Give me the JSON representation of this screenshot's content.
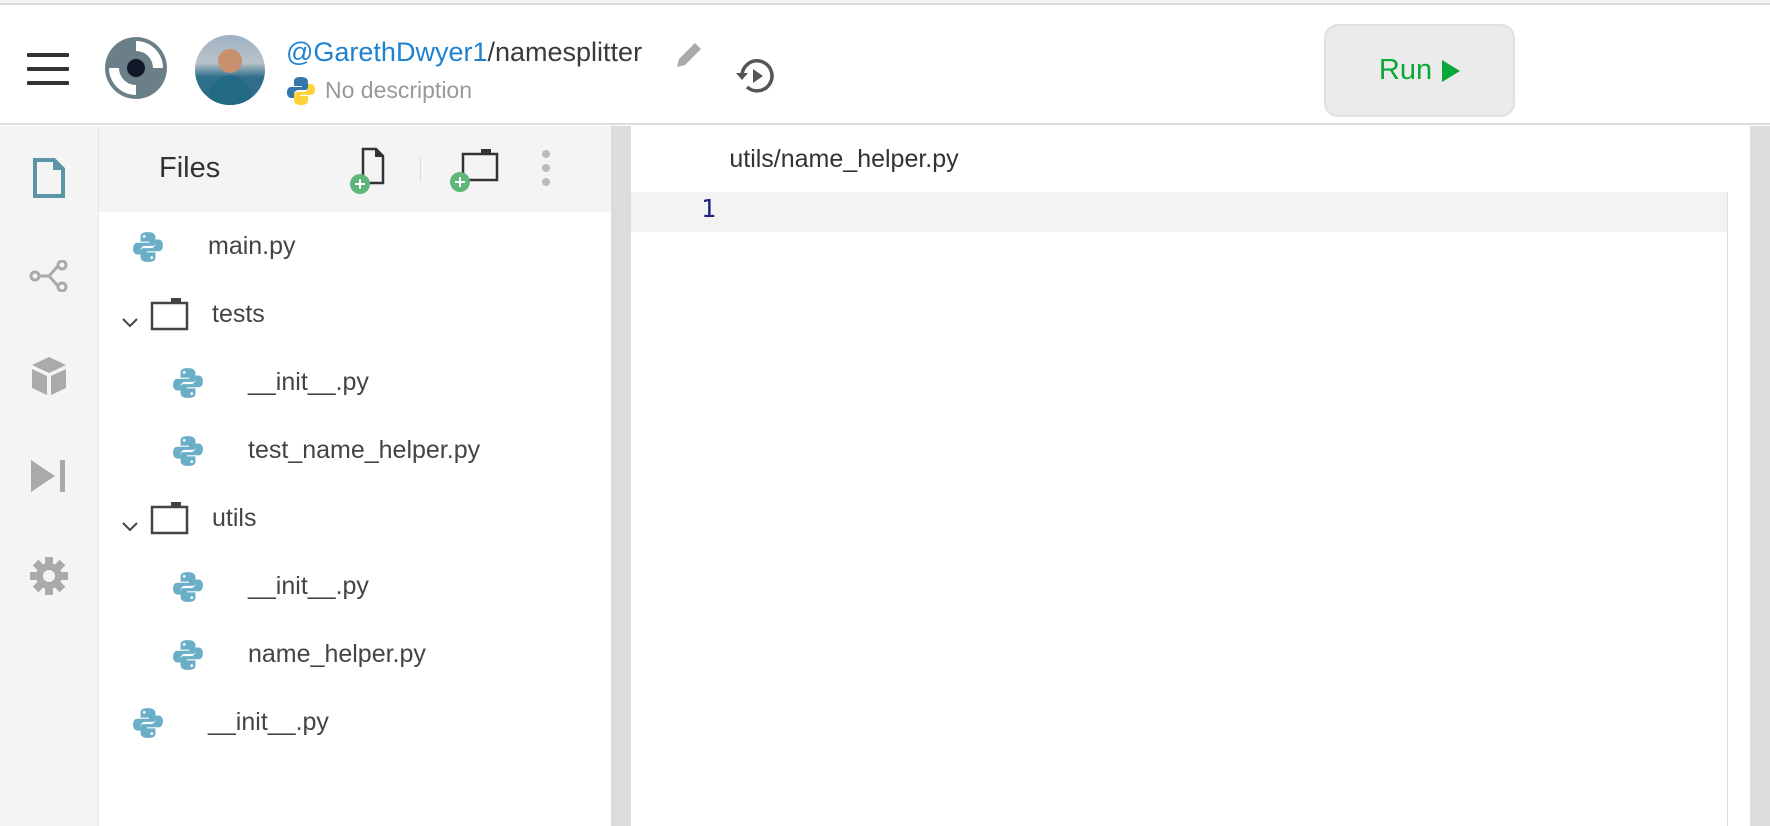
{
  "header": {
    "user": "@GarethDwyer1",
    "separator": "/",
    "repl_name": "namesplitter",
    "description": "No description",
    "run_label": "Run"
  },
  "activity_bar": {
    "items": [
      "files",
      "version-control",
      "packages",
      "debugger",
      "settings"
    ]
  },
  "files_panel": {
    "title": "Files",
    "tree": [
      {
        "type": "file",
        "name": "main.py",
        "depth": 0
      },
      {
        "type": "folder",
        "name": "tests",
        "depth": 0,
        "expanded": true
      },
      {
        "type": "file",
        "name": "__init__.py",
        "depth": 1
      },
      {
        "type": "file",
        "name": "test_name_helper.py",
        "depth": 1
      },
      {
        "type": "folder",
        "name": "utils",
        "depth": 0,
        "expanded": true
      },
      {
        "type": "file",
        "name": "__init__.py",
        "depth": 1
      },
      {
        "type": "file",
        "name": "name_helper.py",
        "depth": 1
      },
      {
        "type": "file",
        "name": "__init__.py",
        "depth": 0
      }
    ]
  },
  "editor": {
    "tab": "utils/name_helper.py",
    "line_numbers": [
      "1"
    ]
  },
  "colors": {
    "accent_blue": "#1e82d0",
    "run_green": "#0aa83a",
    "python_icon": "#6aaec8"
  }
}
